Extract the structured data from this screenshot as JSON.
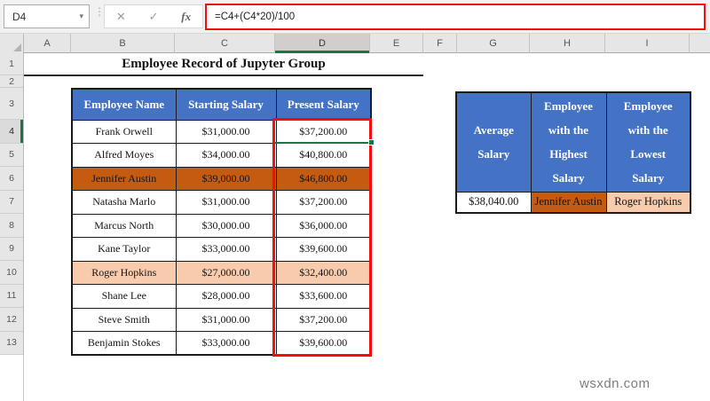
{
  "formula_bar": {
    "name_box_value": "D4",
    "formula": "=C4+(C4*20)/100",
    "fx_label": "fx"
  },
  "icons": {
    "dropdown": "▾",
    "separator_dots": "⋮",
    "cancel": "✕",
    "enter": "✓"
  },
  "column_headers": [
    "A",
    "B",
    "C",
    "D",
    "E",
    "F",
    "G",
    "H",
    "I"
  ],
  "row_headers": [
    "1",
    "2",
    "3",
    "4",
    "5",
    "6",
    "7",
    "8",
    "9",
    "10",
    "11",
    "12",
    "13"
  ],
  "sheet": {
    "title": "Employee Record of Jupyter Group",
    "main_table": {
      "headers": [
        "Employee Name",
        "Starting Salary",
        "Present Salary"
      ],
      "rows": [
        {
          "name": "Frank Orwell",
          "starting": "$31,000.00",
          "present": "$37,200.00"
        },
        {
          "name": "Alfred Moyes",
          "starting": "$34,000.00",
          "present": "$40,800.00"
        },
        {
          "name": "Jennifer Austin",
          "starting": "$39,000.00",
          "present": "$46,800.00"
        },
        {
          "name": "Natasha Marlo",
          "starting": "$31,000.00",
          "present": "$37,200.00"
        },
        {
          "name": "Marcus North",
          "starting": "$30,000.00",
          "present": "$36,000.00"
        },
        {
          "name": "Kane Taylor",
          "starting": "$33,000.00",
          "present": "$39,600.00"
        },
        {
          "name": "Roger Hopkins",
          "starting": "$27,000.00",
          "present": "$32,400.00"
        },
        {
          "name": "Shane Lee",
          "starting": "$28,000.00",
          "present": "$33,600.00"
        },
        {
          "name": "Steve Smith",
          "starting": "$31,000.00",
          "present": "$37,200.00"
        },
        {
          "name": "Benjamin Stokes",
          "starting": "$33,000.00",
          "present": "$39,600.00"
        }
      ]
    },
    "summary_table": {
      "headers": [
        "Average\nSalary",
        "Employee\nwith the\nHighest\nSalary",
        "Employee\nwith the\nLowest\nSalary"
      ],
      "values": [
        "$38,040.00",
        "Jennifer Austin",
        "Roger Hopkins"
      ]
    }
  },
  "selection": {
    "active_cell": "D4",
    "selected_column": "D",
    "selected_row": "4"
  },
  "colors": {
    "header_blue": "#4472C4",
    "highlight_dark_orange": "#C55A11",
    "highlight_light_orange": "#F8CBAD",
    "annotation_red": "#F30D0D",
    "selection_green": "#1F7244"
  },
  "watermark": "wsxdn.com"
}
